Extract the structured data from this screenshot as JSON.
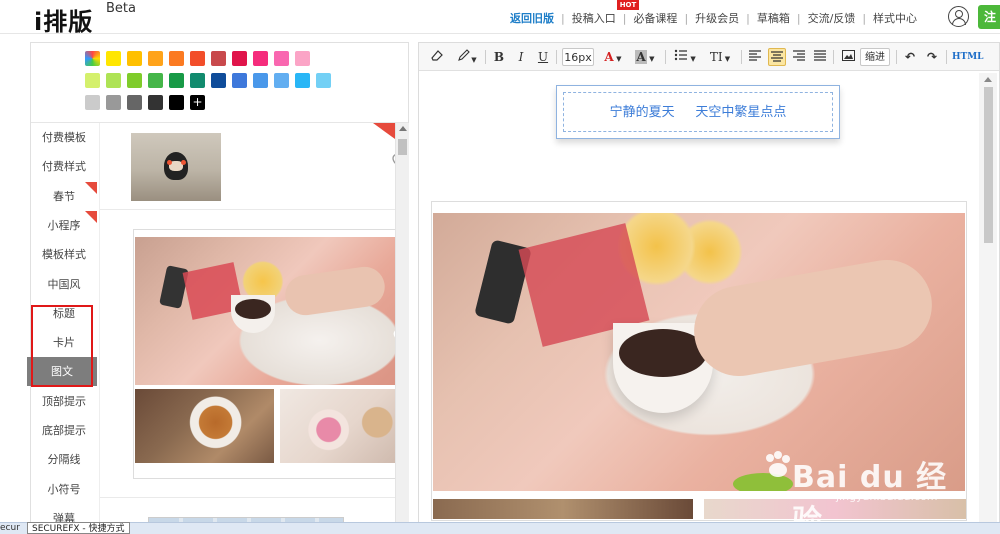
{
  "app": {
    "logo": "i排版",
    "logo_suffix": "Beta"
  },
  "nav": {
    "items": [
      {
        "label": "返回旧版",
        "active": true
      },
      {
        "label": "投稿入口",
        "badge": "HOT"
      },
      {
        "label": "必备课程"
      },
      {
        "label": "升级会员"
      },
      {
        "label": "草稿箱"
      },
      {
        "label": "交流/反馈"
      },
      {
        "label": "样式中心"
      }
    ],
    "register_label": "注"
  },
  "palette": {
    "row1": [
      "multi",
      "#ffe600",
      "#ffc000",
      "#ffa31a",
      "#fb7a22",
      "#f24e2a",
      "#c8494c",
      "#e0144b",
      "#f52c7c",
      "#f967b0",
      "#fba4c6"
    ],
    "row2": [
      "#d4f06c",
      "#aee355",
      "#7fcc2b",
      "#45b649",
      "#189a47",
      "#128b6e",
      "#0f4c9a",
      "#3e78db",
      "#4a98ea",
      "#62aef1",
      "#29b6f6",
      "#73d0f5"
    ],
    "row3": [
      "#cbcbcb",
      "#999999",
      "#666666",
      "#333333",
      "#000000",
      "add"
    ],
    "add_symbol": "+"
  },
  "categories": [
    {
      "label": "付费模板",
      "flag": false
    },
    {
      "label": "付费样式",
      "flag": false
    },
    {
      "label": "春节",
      "flag": true
    },
    {
      "label": "小程序",
      "flag": true
    },
    {
      "label": "模板样式",
      "flag": false
    },
    {
      "label": "中国风",
      "flag": false
    },
    {
      "label": "标题",
      "flag": false
    },
    {
      "label": "卡片",
      "flag": false
    },
    {
      "label": "图文",
      "flag": false,
      "selected": true
    },
    {
      "label": "顶部提示",
      "flag": false
    },
    {
      "label": "底部提示",
      "flag": false
    },
    {
      "label": "分隔线",
      "flag": false
    },
    {
      "label": "小符号",
      "flag": false
    },
    {
      "label": "弹幕",
      "flag": false
    }
  ],
  "toolbar": {
    "font_size": "16px",
    "bold": "B",
    "italic": "I",
    "underline": "U",
    "font_color": "A",
    "bg_color": "A",
    "list": "≡",
    "text_style": "TI",
    "indent_label": "缩进",
    "html_label": "HTML",
    "undo": "↶",
    "redo": "↷"
  },
  "editor": {
    "title_text": "宁静的夏天     天空中繁星点点"
  },
  "watermark": {
    "text": "Bai du 经验",
    "url": "jingyan.baidu.com"
  },
  "status": {
    "tooltip": "SECUREFX - 快捷方式",
    "left_text": "ecur"
  },
  "colors": {
    "accent": "#1e7ec8",
    "title_blue": "#3d7dd8",
    "selected_cat": "#7d7d7d",
    "highlight_red": "#e01818",
    "register_green": "#4cb83a"
  }
}
